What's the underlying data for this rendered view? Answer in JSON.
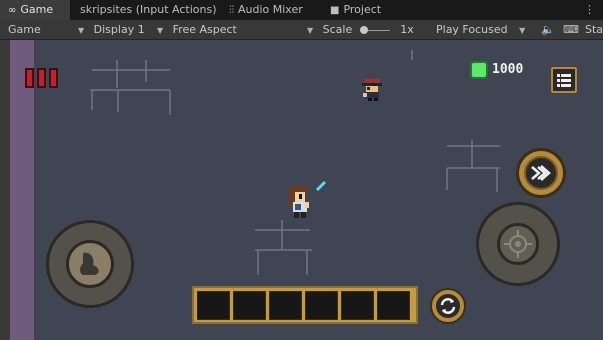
{
  "tabs": [
    {
      "icon": "gamepad-icon",
      "glyph": "●●",
      "label": "Game",
      "active": true
    },
    {
      "icon": "",
      "glyph": "",
      "label": "skripsites (Input Actions)",
      "active": false
    },
    {
      "icon": "audio-mixer-icon",
      "glyph": "⫶⫶",
      "label": "Audio Mixer",
      "active": false
    },
    {
      "icon": "folder-icon",
      "glyph": "■",
      "label": "Project",
      "active": false
    }
  ],
  "tab_more": "⋮",
  "toolbar": {
    "game_dropdown": "Game",
    "display_dropdown": "Display 1",
    "aspect_dropdown": "Free Aspect",
    "scale_label": "Scale",
    "scale_value": "1x",
    "play_mode_dropdown": "Play Focused",
    "stats_label": "Sta"
  },
  "hud": {
    "health_cells": 3,
    "gem_count": "1000"
  },
  "colors": {
    "floor": "#3f4552",
    "wall_purple": "#6f5c7d",
    "health": "#c0212a",
    "gem": "#5ee86a",
    "hud_gold": "#c39a46"
  },
  "inventory_slots": 6
}
